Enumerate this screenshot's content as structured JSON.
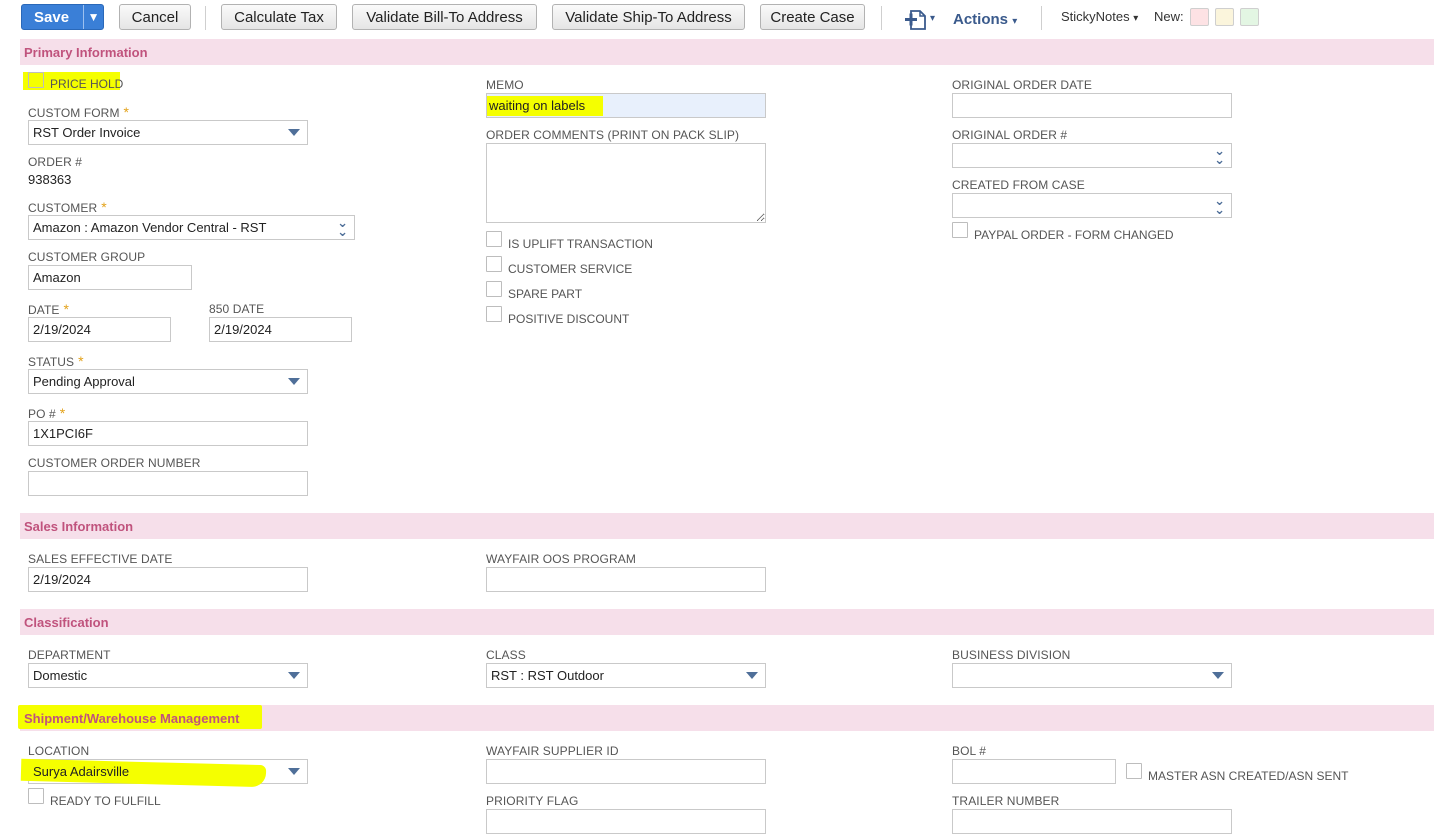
{
  "toolbar": {
    "save": "Save",
    "save_menu": "▼",
    "cancel": "Cancel",
    "calculate_tax": "Calculate Tax",
    "validate_bill_to": "Validate Bill-To Address",
    "validate_ship_to": "Validate Ship-To Address",
    "create_case": "Create Case",
    "actions": "Actions",
    "actions_caret": "▾",
    "add_caret": "▾",
    "sticky_notes": "StickyNotes",
    "sticky_caret": "▾",
    "new_label": "New:",
    "swatch_colors": [
      "#fde2e4",
      "#fbf5dc",
      "#e3f6e3"
    ]
  },
  "sections": {
    "primary": "Primary Information",
    "sales": "Sales Information",
    "classification": "Classification",
    "shipment": "Shipment/Warehouse Management"
  },
  "primary": {
    "price_hold": "PRICE HOLD",
    "custom_form_label": "CUSTOM FORM",
    "custom_form_value": "RST Order Invoice",
    "order_num_label": "ORDER #",
    "order_num_value": "938363",
    "customer_label": "CUSTOMER",
    "customer_value": "Amazon : Amazon Vendor Central - RST",
    "customer_group_label": "CUSTOMER GROUP",
    "customer_group_value": "Amazon",
    "date_label": "DATE",
    "date_value": "2/19/2024",
    "date850_label": "850 DATE",
    "date850_value": "2/19/2024",
    "status_label": "STATUS",
    "status_value": "Pending Approval",
    "po_label": "PO #",
    "po_value": "1X1PCI6F",
    "customer_order_number_label": "CUSTOMER ORDER NUMBER",
    "customer_order_number_value": "",
    "memo_label": "MEMO",
    "memo_value": "waiting on labels",
    "order_comments_label": "ORDER COMMENTS (PRINT ON PACK SLIP)",
    "order_comments_value": "",
    "is_uplift": "IS UPLIFT TRANSACTION",
    "customer_service": "CUSTOMER SERVICE",
    "spare_part": "SPARE PART",
    "positive_discount": "POSITIVE DISCOUNT",
    "original_order_date_label": "ORIGINAL ORDER DATE",
    "original_order_date_value": "",
    "original_order_num_label": "ORIGINAL ORDER #",
    "original_order_num_value": "",
    "created_from_case_label": "CREATED FROM CASE",
    "created_from_case_value": "",
    "paypal_order": "PAYPAL ORDER - FORM CHANGED"
  },
  "sales": {
    "effective_date_label": "SALES EFFECTIVE DATE",
    "effective_date_value": "2/19/2024",
    "wayfair_oos_label": "WAYFAIR OOS PROGRAM",
    "wayfair_oos_value": ""
  },
  "classification": {
    "department_label": "DEPARTMENT",
    "department_value": "Domestic",
    "class_label": "CLASS",
    "class_value": "RST : RST Outdoor",
    "business_division_label": "BUSINESS DIVISION",
    "business_division_value": ""
  },
  "shipment": {
    "location_label": "LOCATION",
    "location_value": "Surya Adairsville",
    "ready_to_fulfill": "READY TO FULFILL",
    "wayfair_supplier_label": "WAYFAIR SUPPLIER ID",
    "wayfair_supplier_value": "",
    "priority_flag_label": "PRIORITY FLAG",
    "bol_label": "BOL #",
    "bol_value": "",
    "master_asn": "MASTER ASN CREATED/ASN SENT",
    "trailer_number_label": "TRAILER NUMBER"
  },
  "required_mark": "*"
}
